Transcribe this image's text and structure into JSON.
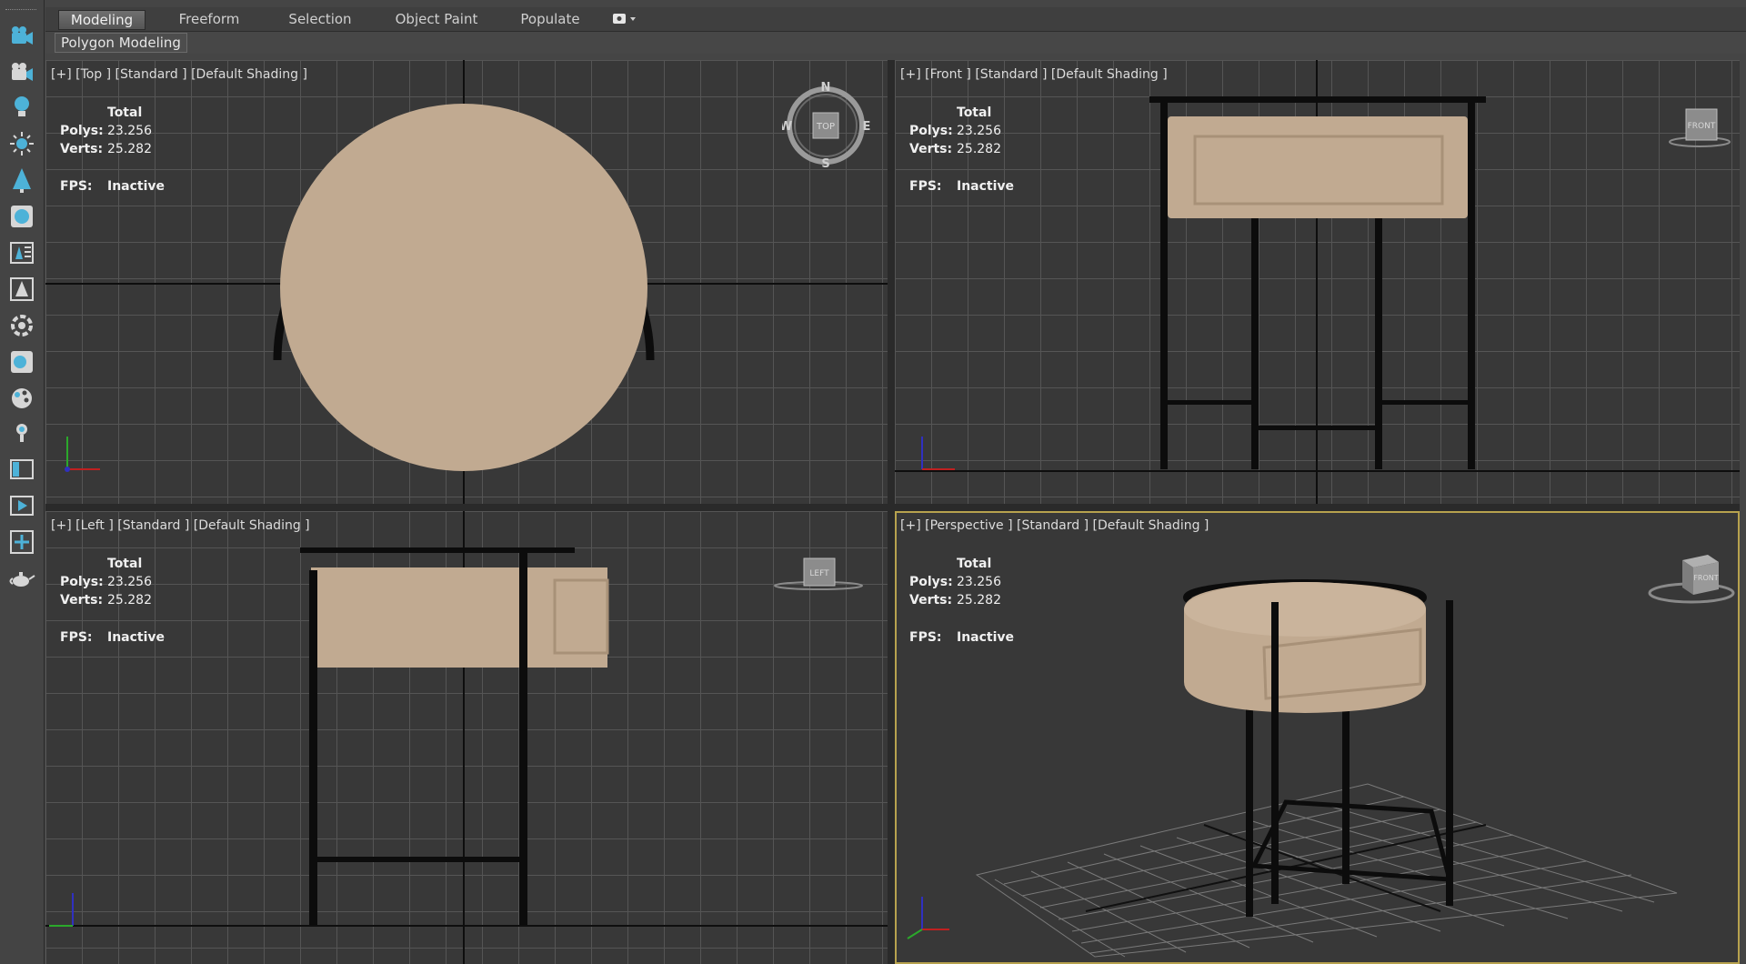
{
  "ribbon": {
    "tabs": [
      "Modeling",
      "Freeform",
      "Selection",
      "Object Paint",
      "Populate"
    ],
    "active_tab": "Modeling"
  },
  "subbar": {
    "button_label": "Polygon Modeling"
  },
  "stats_labels": {
    "total": "Total",
    "polys": "Polys:",
    "verts": "Verts:",
    "fps": "FPS:"
  },
  "viewports": {
    "top": {
      "label": "[+] [Top ] [Standard ] [Default Shading ]",
      "polys": "23.256",
      "verts": "25.282",
      "fps": "Inactive",
      "compass": {
        "n": "N",
        "s": "S",
        "e": "E",
        "w": "W",
        "cube": "TOP"
      }
    },
    "front": {
      "label": "[+] [Front ] [Standard ] [Default Shading ]",
      "polys": "23.256",
      "verts": "25.282",
      "fps": "Inactive",
      "cube": "FRONT"
    },
    "left": {
      "label": "[+] [Left ] [Standard ] [Default Shading ]",
      "polys": "23.256",
      "verts": "25.282",
      "fps": "Inactive",
      "cube": "LEFT"
    },
    "perspective": {
      "label": "[+] [Perspective ] [Standard ] [Default Shading ]",
      "polys": "23.256",
      "verts": "25.282",
      "fps": "Inactive",
      "cube": "FRONT"
    }
  },
  "colors": {
    "wood": "#c1aa91",
    "active_border": "#b7a24e",
    "accent_icon": "#4db2d8"
  }
}
